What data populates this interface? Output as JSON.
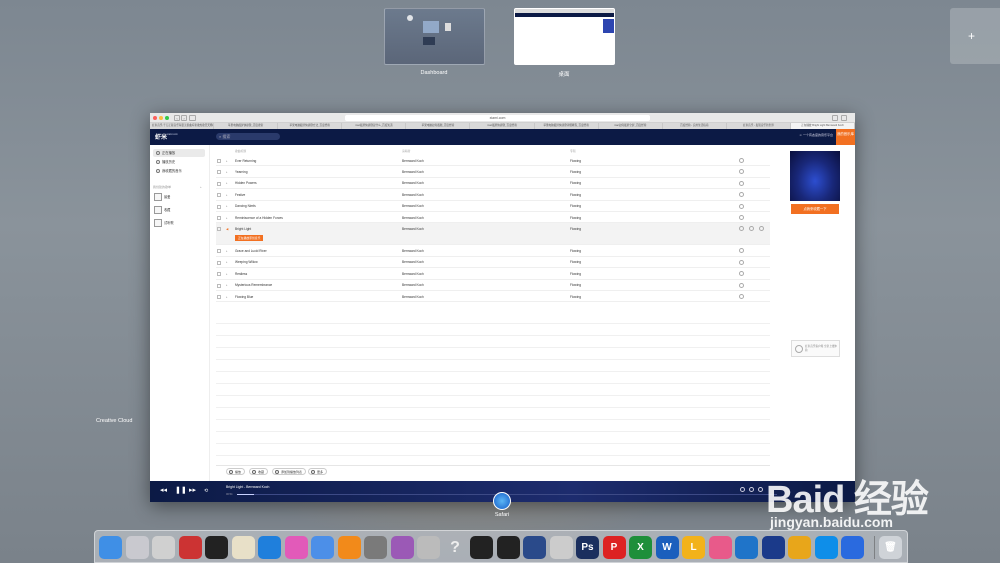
{
  "spaces": {
    "dashboard_label": "Dashboard",
    "desktop_label": "桌面",
    "add_space_symbol": "+"
  },
  "window": {
    "url": "xiami.com",
    "tabs": [
      "虾米音乐-千万正版音乐海量无损曲库新歌热歌天天畅听的高品质音乐平台！",
      "苹果电脑截屏快捷键_百度搜索",
      "苹果电脑截屏快捷键方法_百度经验",
      "mac截屏快捷键是什么_百度知道",
      "苹果电脑如何截图_百度经验",
      "mac截屏快捷键_百度经验",
      "苹果电脑截屏快捷键详细教程_百度经验",
      "mac如何截屏全屏_百度经验",
      "百度经验 - 实用生活指南",
      "虾米音乐 - 发现音乐新世界",
      "正在播放 Bright Light Bernward Koch"
    ],
    "header": {
      "logo": "虾米",
      "logo_sub": "xiami.com",
      "search_placeholder": "搜索",
      "user_text": "一个有态度的音乐平台",
      "login_label": "我的音乐库"
    },
    "sidebar": {
      "items": [
        {
          "label": "正在播放"
        },
        {
          "label": "播放历史"
        },
        {
          "label": "我收藏的音乐"
        }
      ],
      "section_title": "我创建的歌单",
      "section_add": "+",
      "playlists": [
        {
          "label": "最爱"
        },
        {
          "label": "收藏"
        },
        {
          "label": "试听歌"
        }
      ]
    },
    "tracklist": {
      "headers": {
        "title": "歌曲标题",
        "artist": "演唱者",
        "album": "专辑"
      },
      "rows": [
        {
          "title": "Ever Returning",
          "artist": "Bernward Koch",
          "album": "Flowing"
        },
        {
          "title": "Yearning",
          "artist": "Bernward Koch",
          "album": "Flowing"
        },
        {
          "title": "Hidden Powers",
          "artist": "Bernward Koch",
          "album": "Flowing"
        },
        {
          "title": "Festive",
          "artist": "Bernward Koch",
          "album": "Flowing"
        },
        {
          "title": "Dancing Nimfs",
          "artist": "Bernward Koch",
          "album": "Flowing"
        },
        {
          "title": "Reminiscence of a Hidden Forces",
          "artist": "Bernward Koch",
          "album": "Flowing"
        },
        {
          "title": "Bright Light",
          "artist": "Bernward Koch",
          "album": "Flowing",
          "tag": "正在播放原创音乐"
        },
        {
          "title": "Grace and Lucid River",
          "artist": "Bernward Koch",
          "album": "Flowing"
        },
        {
          "title": "Weeping Willow",
          "artist": "Bernward Koch",
          "album": "Flowing"
        },
        {
          "title": "Restless",
          "artist": "Bernward Koch",
          "album": "Flowing"
        },
        {
          "title": "Mysterious Remembrance",
          "artist": "Bernward Koch",
          "album": "Flowing"
        },
        {
          "title": "Flowing Blue",
          "artist": "Bernward Koch",
          "album": "Flowing"
        }
      ]
    },
    "toolbar": {
      "play_label": "播放",
      "fav_label": "收藏",
      "add_label": "添加到播放列表",
      "more_label": "更多"
    },
    "ad": {
      "button_label": "点我来收藏一下",
      "promo_text": "虾米音乐客户端 全新上线体验"
    },
    "player": {
      "now_playing": "Bright Light - Bernward Koch",
      "time": "00:54",
      "progress": 0.032
    }
  },
  "labels": {
    "creative_cloud": "Creative Cloud",
    "safari": "Safari"
  },
  "watermark": {
    "logo": "Baid 经验",
    "url": "jingyan.baidu.com"
  },
  "dock_icons": [
    "finder-icon",
    "launchpad-icon",
    "no-entry-icon",
    "photo-booth-icon",
    "final-cut-icon",
    "preview-icon",
    "safari-icon",
    "itunes-icon",
    "keynote-icon",
    "ibooks-icon",
    "system-preferences-icon",
    "game-center-icon",
    "script-editor-icon",
    "help-icon",
    "qq-icon",
    "qq2-icon",
    "imovie-icon",
    "dvd-player-icon",
    "photoshop-icon",
    "wps-presentation-icon",
    "wps-spreadsheet-icon",
    "wps-writer-icon",
    "lync-icon",
    "photos-icon",
    "feishu-icon",
    "quicktime-icon",
    "ad-icon",
    "teamviewer-icon",
    "vpn-shield-icon",
    "trash-icon"
  ],
  "colors": {
    "header_bg": "#0c1a45",
    "accent": "#f27021"
  }
}
